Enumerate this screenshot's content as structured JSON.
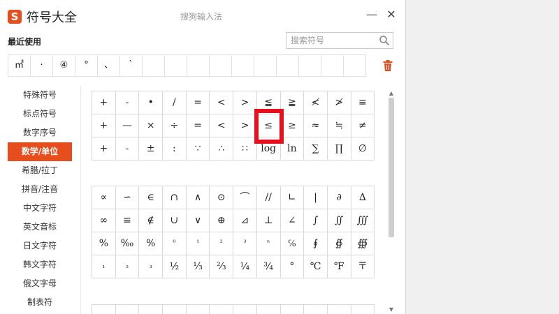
{
  "window": {
    "title": "符号大全",
    "app_name": "搜狗输入法",
    "logo_char": "S",
    "minimize": "—",
    "close": "✕"
  },
  "recent": {
    "label": "最近使用",
    "items": [
      "㎡",
      "·",
      "④",
      "°",
      "、",
      "`",
      "",
      "",
      "",
      "",
      "",
      "",
      "",
      "",
      "",
      ""
    ]
  },
  "search": {
    "placeholder": "搜索符号"
  },
  "sidebar": {
    "items": [
      {
        "label": "特殊符号"
      },
      {
        "label": "标点符号"
      },
      {
        "label": "数字序号"
      },
      {
        "label": "数学/单位"
      },
      {
        "label": "希腊/拉丁"
      },
      {
        "label": "拼音/注音"
      },
      {
        "label": "中文字符"
      },
      {
        "label": "英文音标"
      },
      {
        "label": "日文字符"
      },
      {
        "label": "韩文字符"
      },
      {
        "label": "俄文字母"
      },
      {
        "label": "制表符"
      }
    ],
    "active_index": 3
  },
  "group1": [
    "+",
    "-",
    "•",
    "/",
    "=",
    "<",
    ">",
    "≦",
    "≧",
    "≮",
    "≯",
    "≡",
    "+",
    "—",
    "×",
    "÷",
    "=",
    "<",
    ">",
    "≤",
    "≥",
    "≈",
    "≒",
    "≠",
    "+",
    "-",
    "±",
    ":",
    "∵",
    "∴",
    "∷",
    "log",
    "ln",
    "∑",
    "∏",
    "∅"
  ],
  "group2": [
    "∝",
    "∽",
    "∈",
    "∩",
    "∧",
    "⊙",
    "⌒",
    "//",
    "∟",
    "|",
    "∂",
    "∆",
    "∞",
    "≌",
    "∉",
    "∪",
    "∨",
    "⊕",
    "⊿",
    "⊥",
    "∠",
    "∫",
    "∬",
    "∭",
    "%",
    "‰",
    "%",
    "⁰",
    "¹",
    "²",
    "³",
    "ⁿ",
    "℅",
    "∮",
    "∯",
    "∰",
    "₁",
    "₂",
    "₃",
    "½",
    "⅓",
    "⅔",
    "¼",
    "¾",
    "°",
    "℃",
    "℉",
    "〒"
  ],
  "colors": {
    "accent": "#e74e1e",
    "highlight": "#e8101e"
  },
  "icons": {
    "search": "search-icon",
    "trash": "trash-icon"
  }
}
